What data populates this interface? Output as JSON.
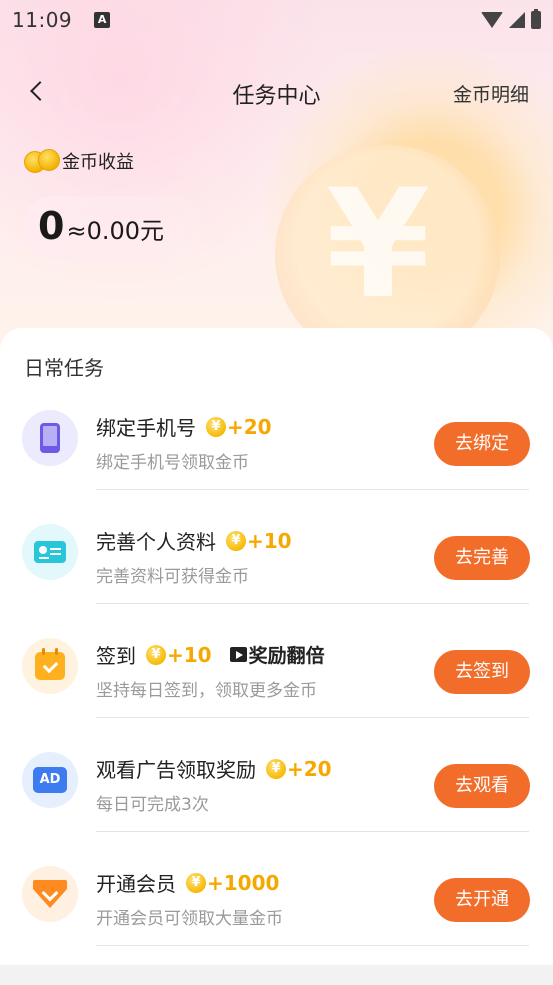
{
  "status_bar": {
    "time": "11:09",
    "notification_letter": "A"
  },
  "nav": {
    "title": "任务中心",
    "right_link": "金币明细"
  },
  "earnings": {
    "label": "金币收益",
    "coins": "0",
    "approx": "≈0.00元"
  },
  "section_title": "日常任务",
  "coin_symbol": "¥",
  "tasks": [
    {
      "name": "绑定手机号",
      "reward": "+20",
      "desc": "绑定手机号领取金币",
      "button": "去绑定",
      "icon": "phone-icon",
      "color": "#6b5be6"
    },
    {
      "name": "完善个人资料",
      "reward": "+10",
      "desc": "完善资料可获得金币",
      "button": "去完善",
      "icon": "id-card-icon",
      "color": "#27c6d8"
    },
    {
      "name": "签到",
      "reward": "+10",
      "bonus": "奖励翻倍",
      "desc": "坚持每日签到，领取更多金币",
      "button": "去签到",
      "icon": "calendar-check-icon",
      "color": "#ffb01f"
    },
    {
      "name": "观看广告领取奖励",
      "reward": "+20",
      "desc": "每日可完成3次",
      "button": "去观看",
      "icon": "ad-tv-icon",
      "icon_text": "AD",
      "color": "#3d7bf0"
    },
    {
      "name": "开通会员",
      "reward": "+1000",
      "desc": "开通会员可领取大量金币",
      "button": "去开通",
      "icon": "vip-gem-icon",
      "color": "#ff8a1f"
    }
  ],
  "colors": {
    "accent_button": "#f26c2a",
    "reward_gold": "#f5a800"
  }
}
